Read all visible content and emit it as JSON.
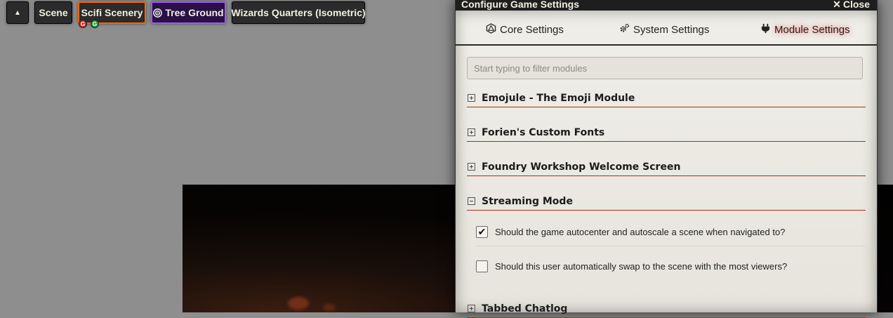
{
  "scene_nav": {
    "toggle_icon": "▲",
    "buttons": [
      "Scene",
      "Scifi Scenery",
      "Tree Ground",
      "Wizards Quarters (Isometric)"
    ],
    "indicators": [
      "G",
      "G"
    ]
  },
  "window": {
    "title": "Configure Game Settings",
    "close_label": "Close",
    "tabs": [
      "Core Settings",
      "System Settings",
      "Module Settings"
    ],
    "filter_placeholder": "Start typing to filter modules",
    "modules": [
      {
        "name": "Emojule - The Emoji Module",
        "expanded": false
      },
      {
        "name": "Forien's Custom Fonts",
        "expanded": false
      },
      {
        "name": "Foundry Workshop Welcome Screen",
        "expanded": false
      },
      {
        "name": "Streaming Mode",
        "expanded": true
      },
      {
        "name": "Tabbed Chatlog",
        "expanded": false
      }
    ],
    "settings": [
      {
        "label": "Should the game autocenter and autoscale a scene when navigated to?",
        "checked": true
      },
      {
        "label": "Should this user automatically swap to the scene with the most viewers?",
        "checked": false
      }
    ]
  },
  "colors": {
    "active_scene_border": "#ff6400",
    "tree_ground_bg": "#2b1046",
    "module_rule": "#a8301e"
  }
}
